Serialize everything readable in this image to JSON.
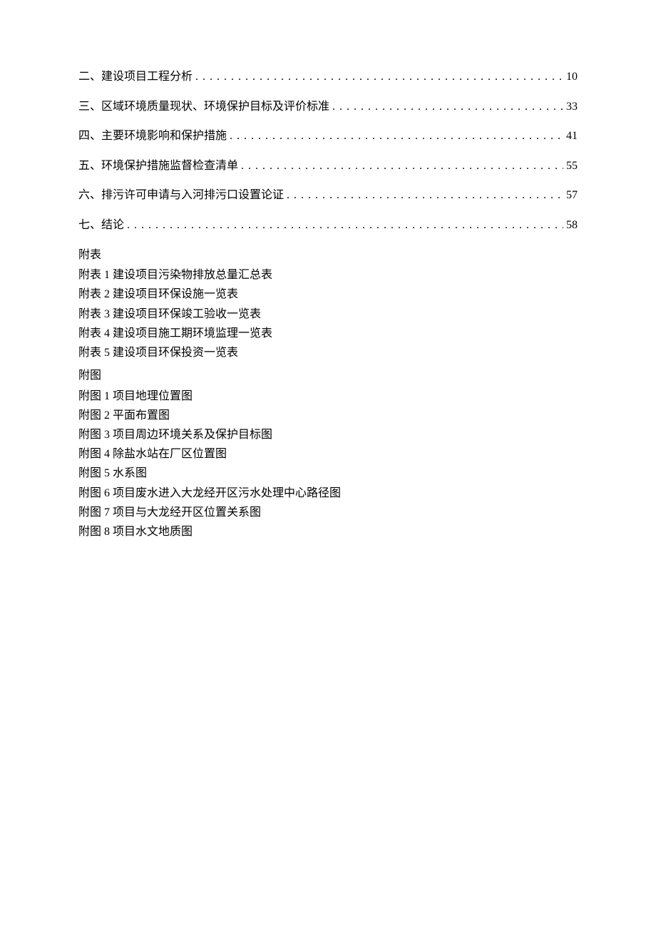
{
  "toc": [
    {
      "title": "二、建设项目工程分析",
      "page": "10"
    },
    {
      "title": "三、区域环境质量现状、环境保护目标及评价标准",
      "page": "33"
    },
    {
      "title": "四、主要环境影响和保护措施",
      "page": "41"
    },
    {
      "title": "五、环境保护措施监督检查清单",
      "page": "55"
    },
    {
      "title": "六、排污许可申请与入河排污口设置论证",
      "page": "57"
    },
    {
      "title": "七、结论",
      "page": "58"
    }
  ],
  "appendix_tables": {
    "heading": "附表",
    "items": [
      "附表 1 建设项目污染物排放总量汇总表",
      "附表 2 建设项目环保设施一览表",
      "附表 3 建设项目环保竣工验收一览表",
      "附表 4 建设项目施工期环境监理一览表",
      "附表 5 建设项目环保投资一览表"
    ]
  },
  "appendix_figures": {
    "heading": "附图",
    "items": [
      "附图 1 项目地理位置图",
      "附图 2 平面布置图",
      "附图 3 项目周边环境关系及保护目标图",
      "附图 4 除盐水站在厂区位置图",
      "附图 5 水系图",
      "附图 6 项目废水进入大龙经开区污水处理中心路径图",
      "附图 7 项目与大龙经开区位置关系图",
      "附图 8 项目水文地质图"
    ]
  }
}
